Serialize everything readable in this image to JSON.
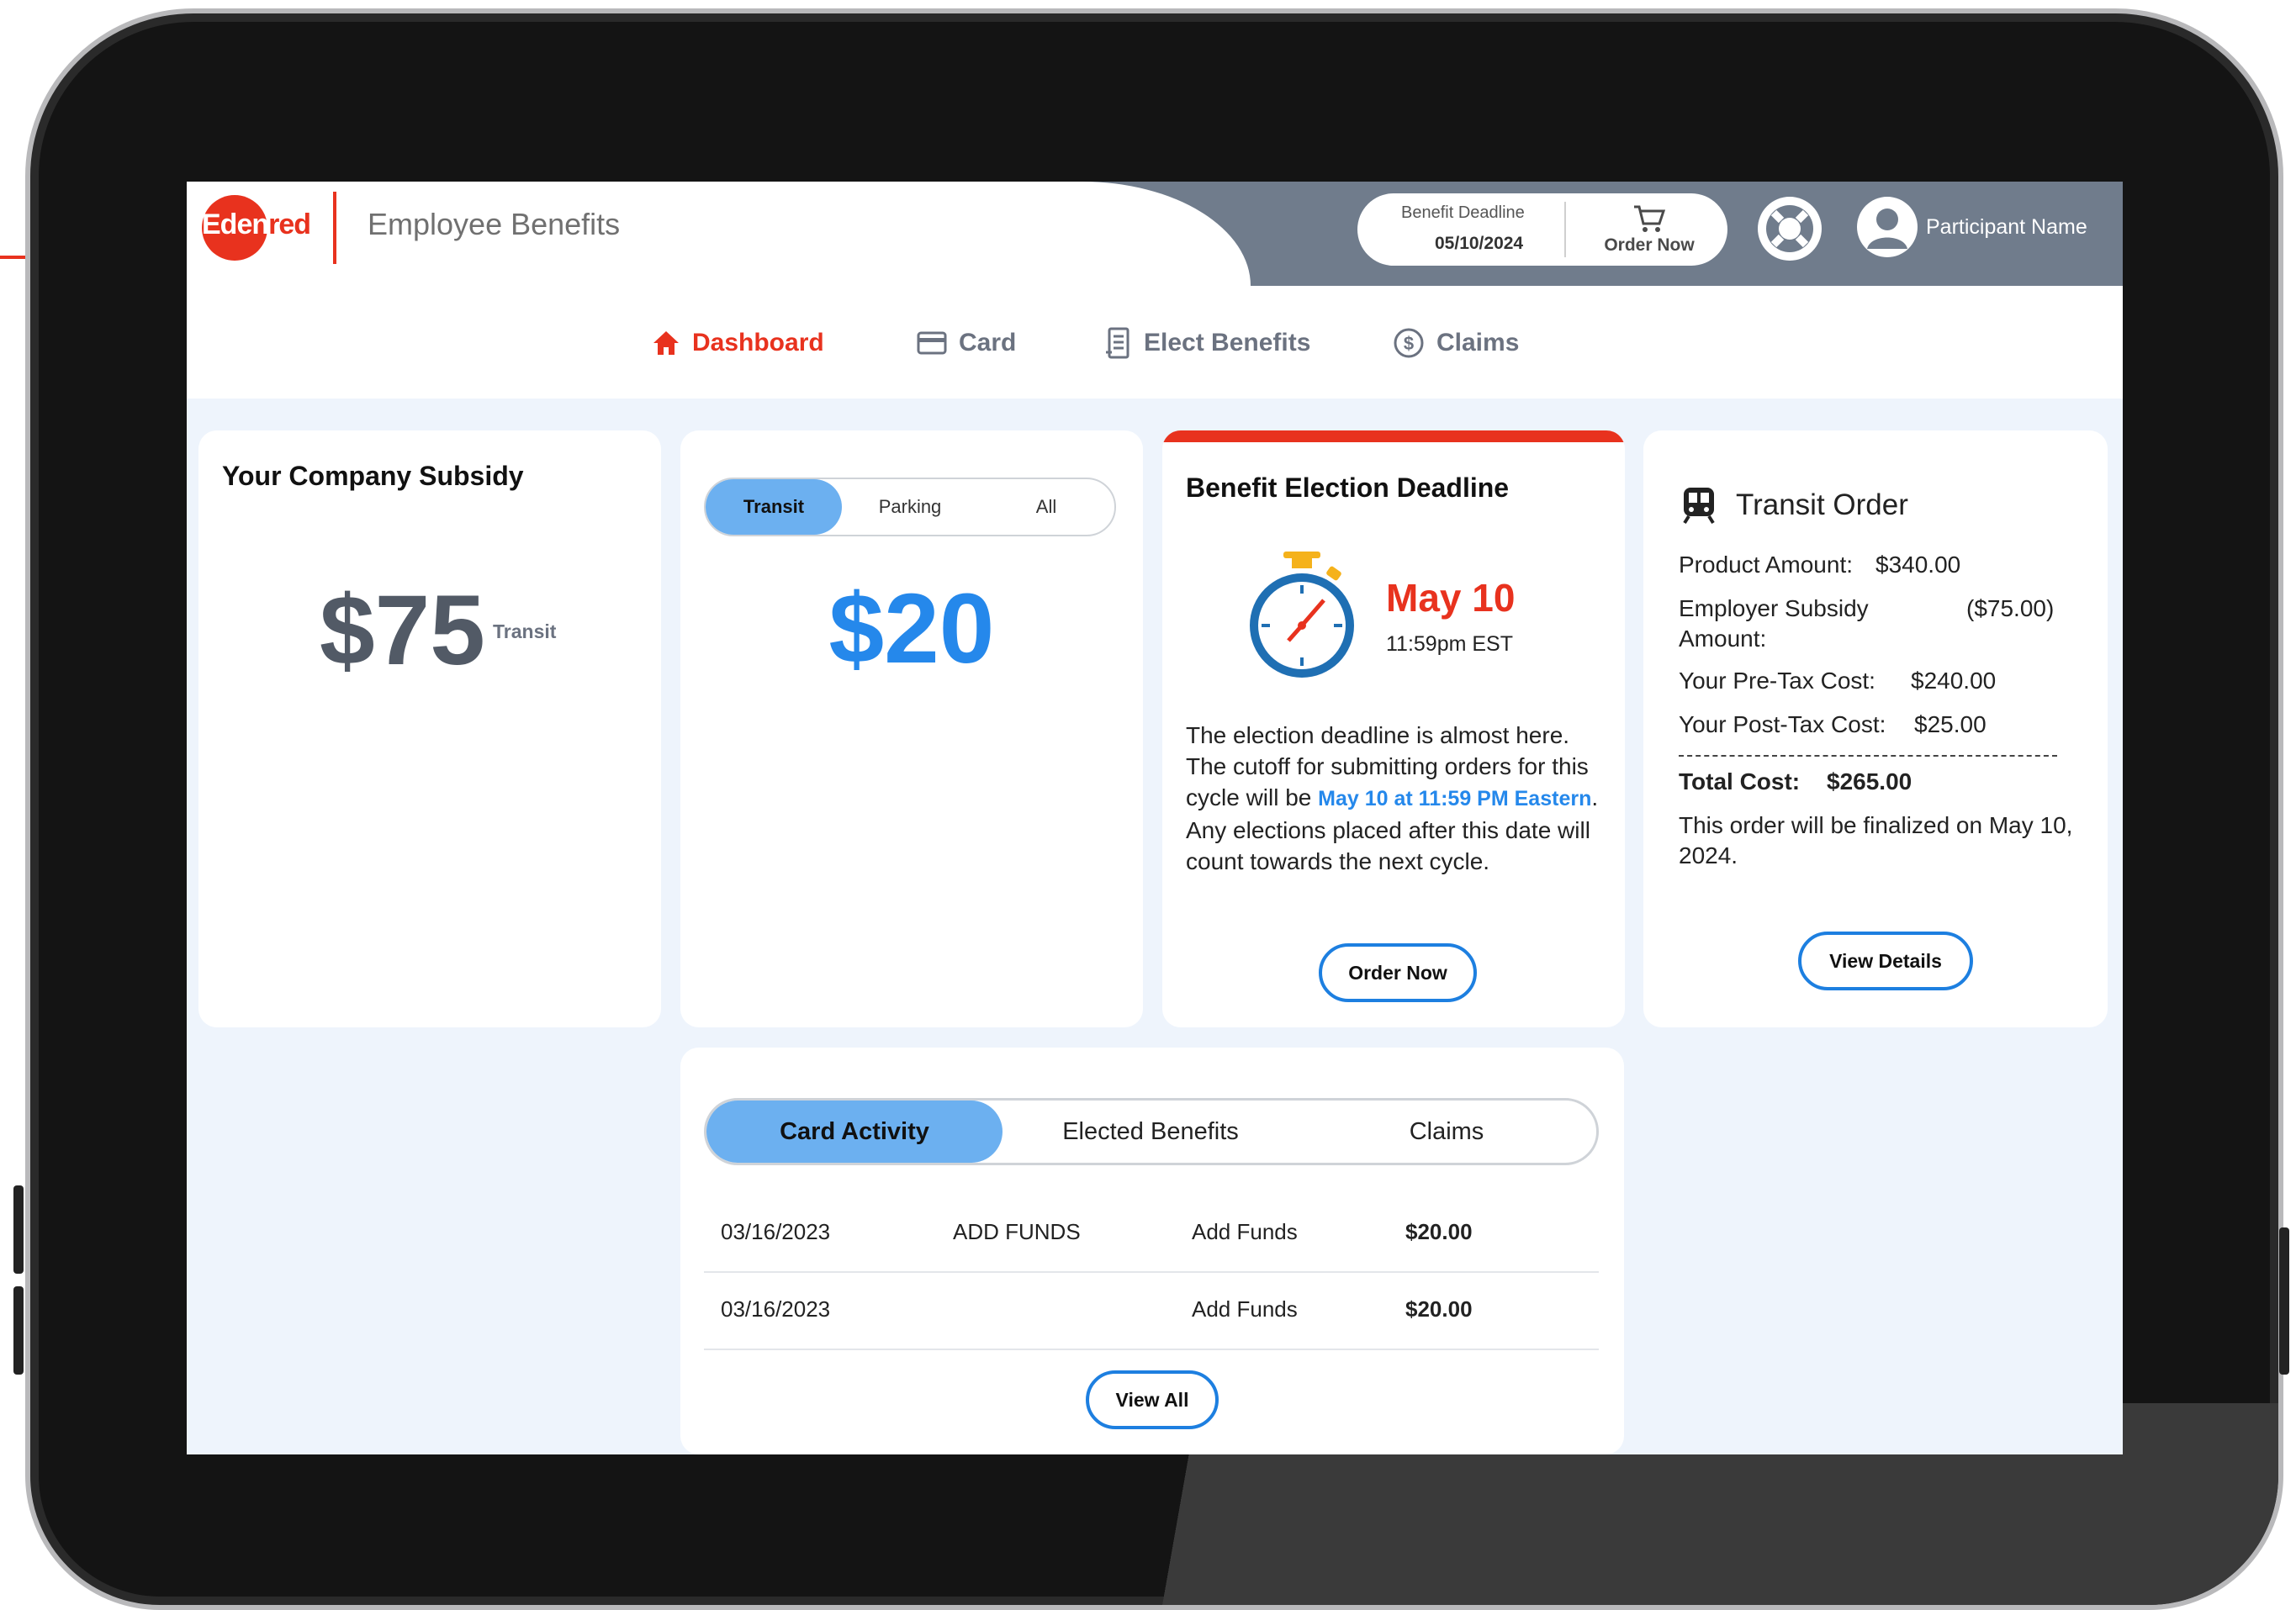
{
  "brand": {
    "logo_text": "Edenred",
    "app_title": "Employee Benefits"
  },
  "colors": {
    "brand_red": "#e8321e",
    "accent_blue": "#2588eb",
    "tab_active": "#6cb0f0",
    "header_gray": "#707c8c"
  },
  "header": {
    "benefit_deadline_label": "Benefit Deadline",
    "benefit_deadline_date": "05/10/2024",
    "order_now_label": "Order Now",
    "order_icon": "cart-icon",
    "help_icon": "lifebuoy-icon",
    "user_icon": "user-avatar-icon",
    "user_name": "Participant Name"
  },
  "nav": [
    {
      "label": "Dashboard",
      "icon": "home-icon"
    },
    {
      "label": "Card",
      "icon": "card-icon"
    },
    {
      "label": "Elect Benefits",
      "icon": "receipt-icon"
    },
    {
      "label": "Claims",
      "icon": "dollar-icon"
    }
  ],
  "subsidy_card": {
    "title": "Your Company Subsidy",
    "amount": "$75",
    "type": "Transit"
  },
  "balance_card": {
    "tabs": [
      "Transit",
      "Parking",
      "All"
    ],
    "active_tab": "Transit",
    "amount": "$20"
  },
  "deadline_card": {
    "title": "Benefit Election Deadline",
    "icon": "stopwatch-icon",
    "date": "May 10",
    "time": "11:59pm EST",
    "body_part1": "The election deadline is almost here. The cutoff for submitting orders for this cycle will be ",
    "body_highlight": "May 10 at 11:59 PM Eastern",
    "body_part2": ".",
    "body_part3": "Any elections placed after this date will count towards the next cycle.",
    "button_label": "Order Now"
  },
  "transit_order": {
    "icon": "train-icon",
    "title": "Transit Order",
    "product_label": "Product Amount:",
    "product_value": "$340.00",
    "employer_label_1": "Employer Subsidy",
    "employer_label_2": "Amount:",
    "employer_value": "($75.00)",
    "pretax_label": "Your Pre-Tax Cost:",
    "pretax_value": "$240.00",
    "posttax_label": "Your Post-Tax Cost:",
    "posttax_value": "$25.00",
    "total_label": "Total Cost:",
    "total_value": "$265.00",
    "note": "This order will be finalized on May 10, 2024.",
    "button_label": "View Details"
  },
  "activity": {
    "tabs": [
      "Card Activity",
      "Elected Benefits",
      "Claims"
    ],
    "active_tab": "Card Activity",
    "rows": [
      {
        "date": "03/16/2023",
        "description": "ADD FUNDS",
        "type": "Add Funds",
        "amount": "$20.00"
      },
      {
        "date": "03/16/2023",
        "description": "",
        "type": "Add Funds",
        "amount": "$20.00"
      }
    ],
    "button_label": "View All"
  }
}
